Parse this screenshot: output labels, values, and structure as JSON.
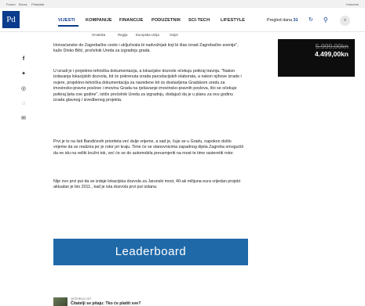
{
  "topbar": {
    "links": [
      "Forum",
      "Burza",
      "Pretplata"
    ],
    "right": "Kolumne"
  },
  "nav": {
    "logo": "Pd",
    "items": [
      "VIJESTI",
      "KOMPANIJE",
      "FINANCIJE",
      "PODUZETNIK",
      "SCI-TECH",
      "LIFESTYLE"
    ],
    "active": "VIJESTI",
    "pregled_label": "Pregled dana",
    "pregled_count": "31"
  },
  "subnav": {
    "items": [
      "Hrvatska",
      "Regija",
      "Europska Unija",
      "Svijet"
    ]
  },
  "social": {
    "icons": [
      "facebook-icon",
      "twitter-icon",
      "whatsapp-icon",
      "viber-icon",
      "email-icon"
    ]
  },
  "article": {
    "paragraphs": [
      "Horvaćanske do Zagrebačke ceste i uključivala bi nadvožnjak koji bi išao iznad Zagrebačke avenije\", kaže Dinko Bilić, pročelnik Ureda za izgradnju grada.",
      "U izradi je i projektno-tehnička dokumentacija, a lokacijske dozvole očekuju potkraj travnja. \"Nakon izdavanja lokacijskih dozvola, bit će pokrenuta izrada parcelacijskih elaborata, a nakon njihove izrade i ovjere, projektno-tehnička dokumentacija za navedene bit će dostavljena Gradskom uredu za imovinsko-pravne poslove i imovinu Grada na rješavanje imovinsko-pravnih poslova, što se očekuje potkraj ljeta ove godine\", ističe pročelnik Ureda za izgradnju, dodajući da je u planu za ovu godinu izrada glavnog i izvedbenog projekta.",
      "Prvi je to na listi Bandićevih prioriteta već dulje vrijeme, a sad je, čuje se u Gradu, napokon došlo vrijeme da se realizira jer je rotor pri kraju. Time će se stanovnicima zapadnog dijela Zagreba omogućiti da ne idu na veliki kružni tok, već će se do automobila preusmjeriti na most te time rasteretiti rotor.",
      "Nije ovo prvi put da se izdaje lokacijska dozvola za Jarunski most, 40-ak milijuna eura vrijedan projekt aktualan je bio 2011., kad je ista dozvola prvi put izdana."
    ]
  },
  "ad": {
    "price_old": "5.999,00kn",
    "price_new": "4.499,00kn"
  },
  "leaderboard": {
    "label": "Leaderboard"
  },
  "related": {
    "tag": "VEČERNJI LIST",
    "title": "Čitatelji se pitaju: Tko će platiti sve?"
  },
  "colors": {
    "brand": "#0b3b8c",
    "leaderboard": "#1f69a8"
  }
}
